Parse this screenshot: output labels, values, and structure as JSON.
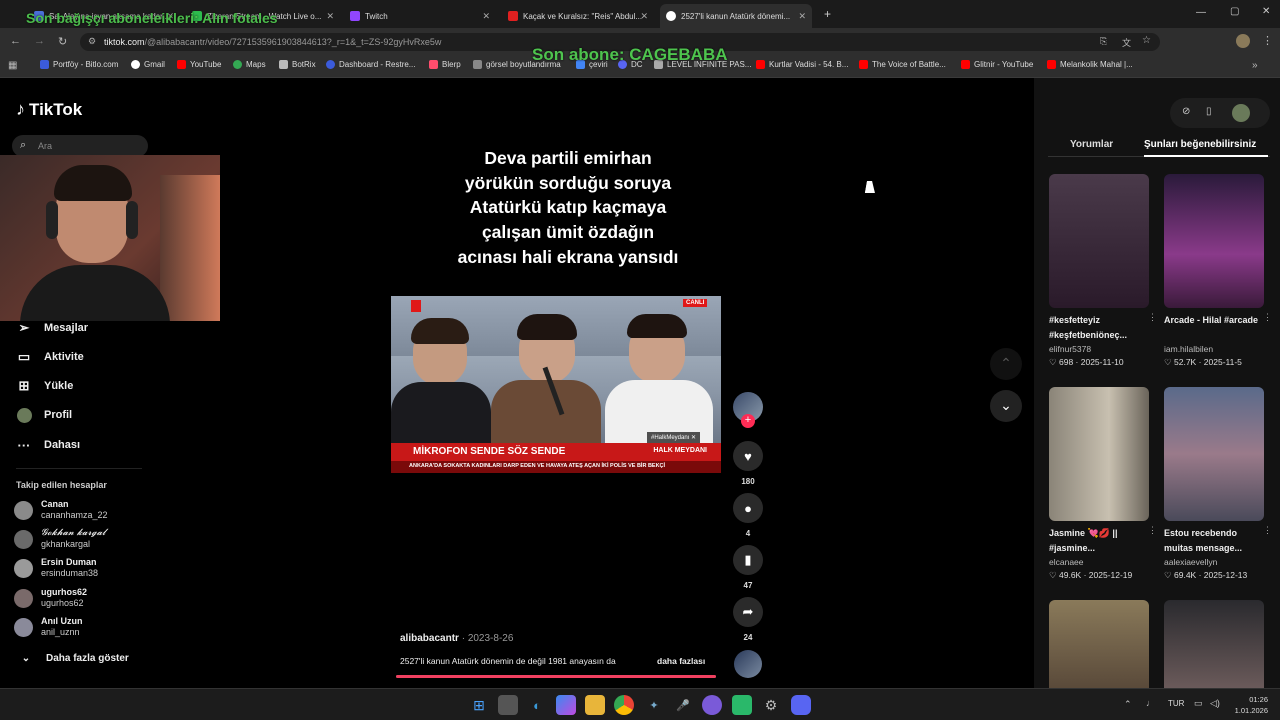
{
  "browser": {
    "tabs": [
      {
        "label": "Sa. Alayına isyan akşama kadar...",
        "color": "#4a6fd8"
      },
      {
        "label": "Zizaran Stream - Watch Live o...",
        "color": "#2dbb4e"
      },
      {
        "label": "Twitch",
        "color": "#9146ff"
      },
      {
        "label": "Kaçak ve Kuralsız: \"Reis\" Abdul...",
        "color": "#e02020"
      },
      {
        "label": "2527'li kanun Atatürk dönemi...",
        "color": "#ffffff"
      }
    ],
    "url_domain": "tiktok.com",
    "url_path": "/@alibabacantr/video/7271535961903844613?_r=1&_t=ZS-92gyHvRxe5w",
    "bookmarks": [
      {
        "label": "Portföy - Bitlo.com",
        "color": "#3b5bdb"
      },
      {
        "label": "Gmail",
        "color": "#ffffff"
      },
      {
        "label": "YouTube",
        "color": "#ff0000"
      },
      {
        "label": "Maps",
        "color": "#34a853"
      },
      {
        "label": "BotRix",
        "color": "#bbbbbb"
      },
      {
        "label": "Dashboard - Restre...",
        "color": "#3b5bdb"
      },
      {
        "label": "Blerp",
        "color": "#ff4d6d"
      },
      {
        "label": "görsel boyutlandırma",
        "color": "#888888"
      },
      {
        "label": "çeviri",
        "color": "#4285f4"
      },
      {
        "label": "DC",
        "color": "#5865f2"
      },
      {
        "label": "LEVEL INFINITE PAS...",
        "color": "#aaaaaa"
      },
      {
        "label": "Kurtlar Vadisi - 54. B...",
        "color": "#ff0000"
      },
      {
        "label": "The Voice of Battle...",
        "color": "#ff0000"
      },
      {
        "label": "Glitnir - YouTube",
        "color": "#ff0000"
      },
      {
        "label": "Melankolik Mahal |...",
        "color": "#ff0000"
      }
    ]
  },
  "stream_overlay": {
    "donor_text": "Son bağışçı aboneleikleri: Alın fotales",
    "subscriber_text": "Son abone: CAGEBABA"
  },
  "tiktok": {
    "logo": "TikTok",
    "search_placeholder": "Ara",
    "nav": [
      {
        "label": "Mesajlar",
        "icon": "send-icon"
      },
      {
        "label": "Aktivite",
        "icon": "activity-icon"
      },
      {
        "label": "Yükle",
        "icon": "upload-icon"
      },
      {
        "label": "Profil",
        "icon": "profile-icon"
      },
      {
        "label": "Dahası",
        "icon": "more-icon"
      }
    ],
    "following_title": "Takip edilen hesaplar",
    "following": [
      {
        "name": "Canan",
        "handle": "cananhamza_22"
      },
      {
        "name": "𝓖𝓸𝓴𝓱𝓪𝓷 𝓴𝓪𝓻𝓰𝓪𝓵",
        "handle": "gkhankargal"
      },
      {
        "name": "Ersin Duman",
        "handle": "ersinduman38"
      },
      {
        "name": "ugurhos62",
        "handle": "ugurhos62"
      },
      {
        "name": "Anıl Uzun",
        "handle": "anil_uznn"
      }
    ],
    "show_more": "Daha fazla göster",
    "video": {
      "caption_lines": [
        "Deva partili emirhan",
        "yörükün sorduğu soruya",
        "Atatürkü katıp kaçmaya",
        "çalışan ümit özdağın",
        "acınası hali ekrana yansıdı"
      ],
      "banner": "MİKROFON SENDE SÖZ SENDE",
      "channel_tag": "HALK MEYDANI",
      "ticker": "ANKARA'DA SOKAKTA KADINLARI DARP EDEN VE HAVAYA ATEŞ AÇAN İKİ POLİS VE BİR BEKÇİ",
      "live_tag": "CANLI",
      "author": "alibabacantr",
      "date": "2023-8-26",
      "description": "2527'li kanun Atatürk dönemin de değil 1981 anayasın da",
      "more": "daha fazlası",
      "counts": {
        "likes": "180",
        "comments": "4",
        "saves": "47",
        "shares": "24"
      }
    },
    "right_tabs": [
      "Yorumlar",
      "Şunları beğenebilirsiniz"
    ],
    "suggestions": [
      {
        "title": "#kesfetteyiz #keşfetbeniöneç...",
        "user": "elifnur5378",
        "likes": "698",
        "date": "2025-11-10",
        "color": "#3a2a3a"
      },
      {
        "title": "Arcade - Hilal #arcade",
        "user": "iam.hilalbilen",
        "likes": "52.7K",
        "date": "2025-11-5",
        "color": "#5a2a6a"
      },
      {
        "title": "Jasmine 💘💋 || #jasmine...",
        "user": "elcanaee",
        "likes": "49.6K",
        "date": "2025-12-19",
        "color": "#6a6458"
      },
      {
        "title": "Estou recebendo muitas mensage...",
        "user": "aalexiaevellyn",
        "likes": "69.4K",
        "date": "2025-12-13",
        "color": "#4a4a5a"
      },
      {
        "title": "",
        "user": "",
        "likes": "",
        "date": "",
        "color": "#6b5a48"
      },
      {
        "title": "",
        "user": "",
        "likes": "",
        "date": "",
        "color": "#2a2a2e"
      }
    ]
  },
  "taskbar": {
    "lang": "TUR",
    "time": "01:26",
    "date": "1.01.2026"
  }
}
